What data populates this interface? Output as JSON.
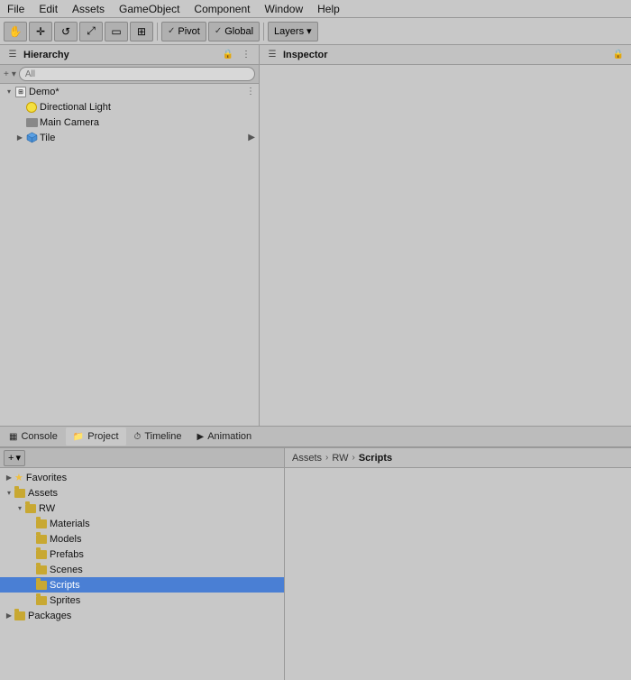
{
  "menubar": {
    "items": [
      "File",
      "Edit",
      "Assets",
      "GameObject",
      "Component",
      "Window",
      "Help"
    ]
  },
  "toolbar": {
    "tools": [
      "hand",
      "move",
      "rotate",
      "scale",
      "rect",
      "transform"
    ],
    "pivot_label": "Pivot",
    "global_label": "Global",
    "layers_label": "Layers"
  },
  "hierarchy": {
    "title": "Hierarchy",
    "search_placeholder": "All",
    "items": [
      {
        "label": "Demo*",
        "indent": 0,
        "type": "scene",
        "expanded": true,
        "hasMore": true
      },
      {
        "label": "Directional Light",
        "indent": 1,
        "type": "light"
      },
      {
        "label": "Main Camera",
        "indent": 1,
        "type": "camera"
      },
      {
        "label": "Tile",
        "indent": 1,
        "type": "cube",
        "hasArrow": true
      }
    ]
  },
  "inspector": {
    "title": "Inspector"
  },
  "bottom_tabs": [
    {
      "label": "Console",
      "icon": "console",
      "active": false
    },
    {
      "label": "Project",
      "icon": "project",
      "active": true
    },
    {
      "label": "Timeline",
      "icon": "timeline",
      "active": false
    },
    {
      "label": "Animation",
      "icon": "animation",
      "active": false
    }
  ],
  "project": {
    "add_label": "+",
    "tree": [
      {
        "label": "Favorites",
        "indent": 0,
        "type": "folder",
        "expanded": false
      },
      {
        "label": "Assets",
        "indent": 0,
        "type": "folder",
        "expanded": true
      },
      {
        "label": "RW",
        "indent": 1,
        "type": "folder",
        "expanded": true
      },
      {
        "label": "Materials",
        "indent": 2,
        "type": "folder"
      },
      {
        "label": "Models",
        "indent": 2,
        "type": "folder"
      },
      {
        "label": "Prefabs",
        "indent": 2,
        "type": "folder"
      },
      {
        "label": "Scenes",
        "indent": 2,
        "type": "folder"
      },
      {
        "label": "Scripts",
        "indent": 2,
        "type": "folder",
        "selected": true
      },
      {
        "label": "Sprites",
        "indent": 2,
        "type": "folder"
      },
      {
        "label": "Packages",
        "indent": 0,
        "type": "folder",
        "expanded": false
      }
    ],
    "breadcrumb": [
      "Assets",
      "RW",
      "Scripts"
    ],
    "content_empty": true
  }
}
